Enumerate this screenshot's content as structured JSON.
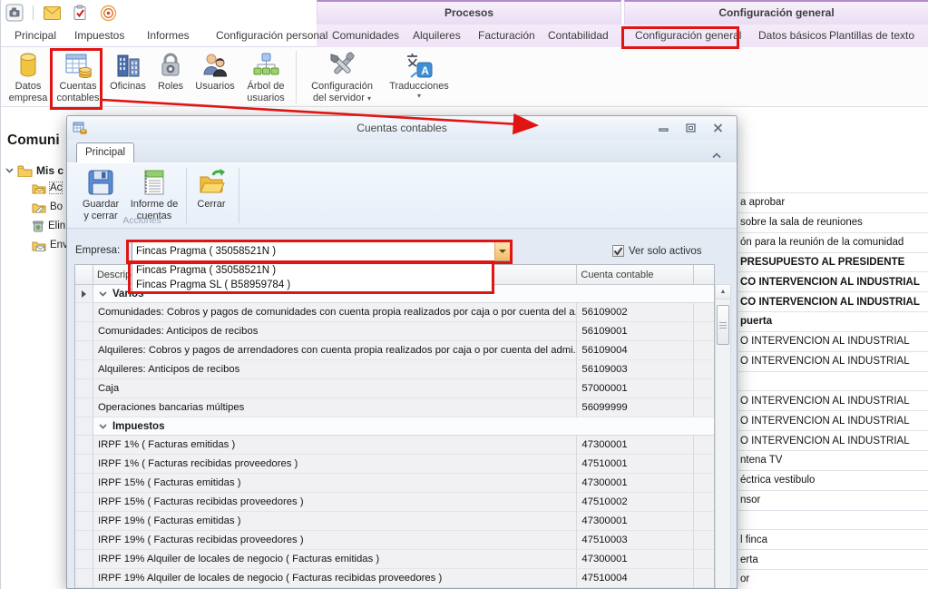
{
  "quick_access_icons": [
    "app-icon",
    "mail-icon",
    "tasks-icon",
    "broadcast-icon"
  ],
  "ribbon": {
    "tabs": [
      "Principal",
      "Impuestos",
      "Informes",
      "Configuración personal"
    ],
    "context_groups": [
      {
        "title": "Procesos",
        "tabs": [
          "Comunidades",
          "Alquileres",
          "Facturación",
          "Contabilidad"
        ]
      },
      {
        "title": "Configuración general",
        "tabs": [
          "Configuración general",
          "Datos básicos",
          "Plantillas de texto"
        ]
      }
    ],
    "buttons": [
      {
        "line1": "Datos",
        "line2": "empresa",
        "icon": "company-database-icon"
      },
      {
        "line1": "Cuentas",
        "line2": "contables",
        "icon": "accounts-table-icon",
        "highlighted": true
      },
      {
        "line1": "Oficinas",
        "line2": "",
        "icon": "offices-icon"
      },
      {
        "line1": "Roles",
        "line2": "",
        "icon": "roles-lock-icon"
      },
      {
        "line1": "Usuarios",
        "line2": "",
        "icon": "users-icon"
      },
      {
        "line1": "Árbol de",
        "line2": "usuarios",
        "icon": "user-tree-icon"
      },
      {
        "line1": "Configuración",
        "line2": "del servidor",
        "icon": "server-config-icon",
        "has_dropdown": true
      },
      {
        "line1": "Traducciones",
        "line2": "",
        "icon": "translations-icon",
        "has_dropdown": true
      }
    ]
  },
  "background_window": {
    "left_panel": {
      "heading": "Comuni",
      "tree_root": "Mis c",
      "tree_items": [
        "Ac",
        "Bo",
        "Elin",
        "Env"
      ]
    },
    "right_list_rows": [
      {
        "text": "a aprobar",
        "bold": false
      },
      {
        "text": "sobre la sala de reuniones",
        "bold": false
      },
      {
        "text": "ón para la reunión de la comunidad",
        "bold": false
      },
      {
        "text": "PRESUPUESTO AL PRESIDENTE",
        "bold": true
      },
      {
        "text": "CO INTERVENCION AL INDUSTRIAL",
        "bold": true
      },
      {
        "text": "CO INTERVENCION AL INDUSTRIAL",
        "bold": true
      },
      {
        "text": "puerta",
        "bold": true
      },
      {
        "text": "O INTERVENCION AL INDUSTRIAL",
        "bold": false
      },
      {
        "text": "O INTERVENCION AL INDUSTRIAL",
        "bold": false
      },
      {
        "text": "",
        "bold": false
      },
      {
        "text": "O INTERVENCION AL INDUSTRIAL",
        "bold": false
      },
      {
        "text": "O INTERVENCION AL INDUSTRIAL",
        "bold": false
      },
      {
        "text": "O INTERVENCION AL INDUSTRIAL",
        "bold": false
      },
      {
        "text": "ntena TV",
        "bold": false
      },
      {
        "text": "éctrica vestibulo",
        "bold": false
      },
      {
        "text": "nsor",
        "bold": false
      },
      {
        "text": "",
        "bold": false
      },
      {
        "text": "l finca",
        "bold": false
      },
      {
        "text": "erta",
        "bold": false
      },
      {
        "text": "or",
        "bold": false
      }
    ]
  },
  "dialog": {
    "title": "Cuentas contables",
    "window_controls": [
      "minimize-icon",
      "maximize-icon",
      "close-icon"
    ],
    "tab": "Principal",
    "toolbar": {
      "group_label": "Acciones",
      "buttons": [
        {
          "line1": "Guardar",
          "line2": "y cerrar",
          "icon": "save-close-icon"
        },
        {
          "line1": "Informe de",
          "line2": "cuentas",
          "icon": "accounts-report-icon"
        },
        {
          "line1": "Cerrar",
          "line2": "",
          "icon": "close-folder-icon"
        }
      ]
    },
    "empresa": {
      "label": "Empresa:",
      "value": "Fincas Pragma ( 35058521N )",
      "options": [
        "Fincas Pragma ( 35058521N )",
        "Fincas Pragma SL ( B58959784 )"
      ]
    },
    "filter_checkbox": {
      "label": "Ver solo activos",
      "checked": true
    },
    "table": {
      "columns": {
        "description": "Descripción",
        "account": "Cuenta contable"
      },
      "rows": [
        {
          "type": "group",
          "desc": "Varios"
        },
        {
          "type": "data",
          "desc": "Comunidades: Cobros y pagos de comunidades con cuenta propia realizados por caja o por cuenta del a...",
          "account": "56109002"
        },
        {
          "type": "data",
          "desc": "Comunidades: Anticipos de recibos",
          "account": "56109001"
        },
        {
          "type": "data",
          "desc": "Alquileres: Cobros y pagos de arrendadores con cuenta propia realizados por caja o por cuenta del admi...",
          "account": "56109004"
        },
        {
          "type": "data",
          "desc": "Alquileres: Anticipos de recibos",
          "account": "56109003"
        },
        {
          "type": "data",
          "desc": "Caja",
          "account": "57000001"
        },
        {
          "type": "data",
          "desc": "Operaciones bancarias múltipes",
          "account": "56099999"
        },
        {
          "type": "group",
          "desc": "Impuestos"
        },
        {
          "type": "data",
          "desc": "IRPF 1% ( Facturas emitidas )",
          "account": "47300001"
        },
        {
          "type": "data",
          "desc": "IRPF 1% ( Facturas recibidas proveedores )",
          "account": "47510001"
        },
        {
          "type": "data",
          "desc": "IRPF 15% ( Facturas emitidas )",
          "account": "47300001"
        },
        {
          "type": "data",
          "desc": "IRPF 15% ( Facturas recibidas proveedores )",
          "account": "47510002"
        },
        {
          "type": "data",
          "desc": "IRPF 19% ( Facturas emitidas )",
          "account": "47300001"
        },
        {
          "type": "data",
          "desc": "IRPF 19% ( Facturas recibidas proveedores )",
          "account": "47510003"
        },
        {
          "type": "data",
          "desc": "IRPF 19% Alquiler de locales de negocio ( Facturas emitidas )",
          "account": "47300001"
        },
        {
          "type": "data",
          "desc": "IRPF 19% Alquiler de locales de negocio ( Facturas recibidas proveedores )",
          "account": "47510004"
        }
      ]
    }
  },
  "annotations": {
    "highlight_color": "#e11414"
  }
}
